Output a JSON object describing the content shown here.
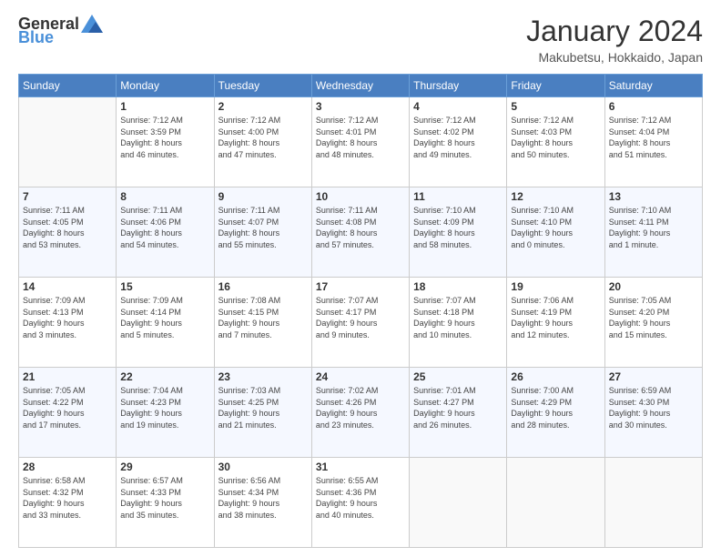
{
  "header": {
    "logo_general": "General",
    "logo_blue": "Blue",
    "month": "January 2024",
    "location": "Makubetsu, Hokkaido, Japan"
  },
  "days_of_week": [
    "Sunday",
    "Monday",
    "Tuesday",
    "Wednesday",
    "Thursday",
    "Friday",
    "Saturday"
  ],
  "weeks": [
    [
      {
        "day": "",
        "info": ""
      },
      {
        "day": "1",
        "info": "Sunrise: 7:12 AM\nSunset: 3:59 PM\nDaylight: 8 hours\nand 46 minutes."
      },
      {
        "day": "2",
        "info": "Sunrise: 7:12 AM\nSunset: 4:00 PM\nDaylight: 8 hours\nand 47 minutes."
      },
      {
        "day": "3",
        "info": "Sunrise: 7:12 AM\nSunset: 4:01 PM\nDaylight: 8 hours\nand 48 minutes."
      },
      {
        "day": "4",
        "info": "Sunrise: 7:12 AM\nSunset: 4:02 PM\nDaylight: 8 hours\nand 49 minutes."
      },
      {
        "day": "5",
        "info": "Sunrise: 7:12 AM\nSunset: 4:03 PM\nDaylight: 8 hours\nand 50 minutes."
      },
      {
        "day": "6",
        "info": "Sunrise: 7:12 AM\nSunset: 4:04 PM\nDaylight: 8 hours\nand 51 minutes."
      }
    ],
    [
      {
        "day": "7",
        "info": "Sunrise: 7:11 AM\nSunset: 4:05 PM\nDaylight: 8 hours\nand 53 minutes."
      },
      {
        "day": "8",
        "info": "Sunrise: 7:11 AM\nSunset: 4:06 PM\nDaylight: 8 hours\nand 54 minutes."
      },
      {
        "day": "9",
        "info": "Sunrise: 7:11 AM\nSunset: 4:07 PM\nDaylight: 8 hours\nand 55 minutes."
      },
      {
        "day": "10",
        "info": "Sunrise: 7:11 AM\nSunset: 4:08 PM\nDaylight: 8 hours\nand 57 minutes."
      },
      {
        "day": "11",
        "info": "Sunrise: 7:10 AM\nSunset: 4:09 PM\nDaylight: 8 hours\nand 58 minutes."
      },
      {
        "day": "12",
        "info": "Sunrise: 7:10 AM\nSunset: 4:10 PM\nDaylight: 9 hours\nand 0 minutes."
      },
      {
        "day": "13",
        "info": "Sunrise: 7:10 AM\nSunset: 4:11 PM\nDaylight: 9 hours\nand 1 minute."
      }
    ],
    [
      {
        "day": "14",
        "info": "Sunrise: 7:09 AM\nSunset: 4:13 PM\nDaylight: 9 hours\nand 3 minutes."
      },
      {
        "day": "15",
        "info": "Sunrise: 7:09 AM\nSunset: 4:14 PM\nDaylight: 9 hours\nand 5 minutes."
      },
      {
        "day": "16",
        "info": "Sunrise: 7:08 AM\nSunset: 4:15 PM\nDaylight: 9 hours\nand 7 minutes."
      },
      {
        "day": "17",
        "info": "Sunrise: 7:07 AM\nSunset: 4:17 PM\nDaylight: 9 hours\nand 9 minutes."
      },
      {
        "day": "18",
        "info": "Sunrise: 7:07 AM\nSunset: 4:18 PM\nDaylight: 9 hours\nand 10 minutes."
      },
      {
        "day": "19",
        "info": "Sunrise: 7:06 AM\nSunset: 4:19 PM\nDaylight: 9 hours\nand 12 minutes."
      },
      {
        "day": "20",
        "info": "Sunrise: 7:05 AM\nSunset: 4:20 PM\nDaylight: 9 hours\nand 15 minutes."
      }
    ],
    [
      {
        "day": "21",
        "info": "Sunrise: 7:05 AM\nSunset: 4:22 PM\nDaylight: 9 hours\nand 17 minutes."
      },
      {
        "day": "22",
        "info": "Sunrise: 7:04 AM\nSunset: 4:23 PM\nDaylight: 9 hours\nand 19 minutes."
      },
      {
        "day": "23",
        "info": "Sunrise: 7:03 AM\nSunset: 4:25 PM\nDaylight: 9 hours\nand 21 minutes."
      },
      {
        "day": "24",
        "info": "Sunrise: 7:02 AM\nSunset: 4:26 PM\nDaylight: 9 hours\nand 23 minutes."
      },
      {
        "day": "25",
        "info": "Sunrise: 7:01 AM\nSunset: 4:27 PM\nDaylight: 9 hours\nand 26 minutes."
      },
      {
        "day": "26",
        "info": "Sunrise: 7:00 AM\nSunset: 4:29 PM\nDaylight: 9 hours\nand 28 minutes."
      },
      {
        "day": "27",
        "info": "Sunrise: 6:59 AM\nSunset: 4:30 PM\nDaylight: 9 hours\nand 30 minutes."
      }
    ],
    [
      {
        "day": "28",
        "info": "Sunrise: 6:58 AM\nSunset: 4:32 PM\nDaylight: 9 hours\nand 33 minutes."
      },
      {
        "day": "29",
        "info": "Sunrise: 6:57 AM\nSunset: 4:33 PM\nDaylight: 9 hours\nand 35 minutes."
      },
      {
        "day": "30",
        "info": "Sunrise: 6:56 AM\nSunset: 4:34 PM\nDaylight: 9 hours\nand 38 minutes."
      },
      {
        "day": "31",
        "info": "Sunrise: 6:55 AM\nSunset: 4:36 PM\nDaylight: 9 hours\nand 40 minutes."
      },
      {
        "day": "",
        "info": ""
      },
      {
        "day": "",
        "info": ""
      },
      {
        "day": "",
        "info": ""
      }
    ]
  ]
}
